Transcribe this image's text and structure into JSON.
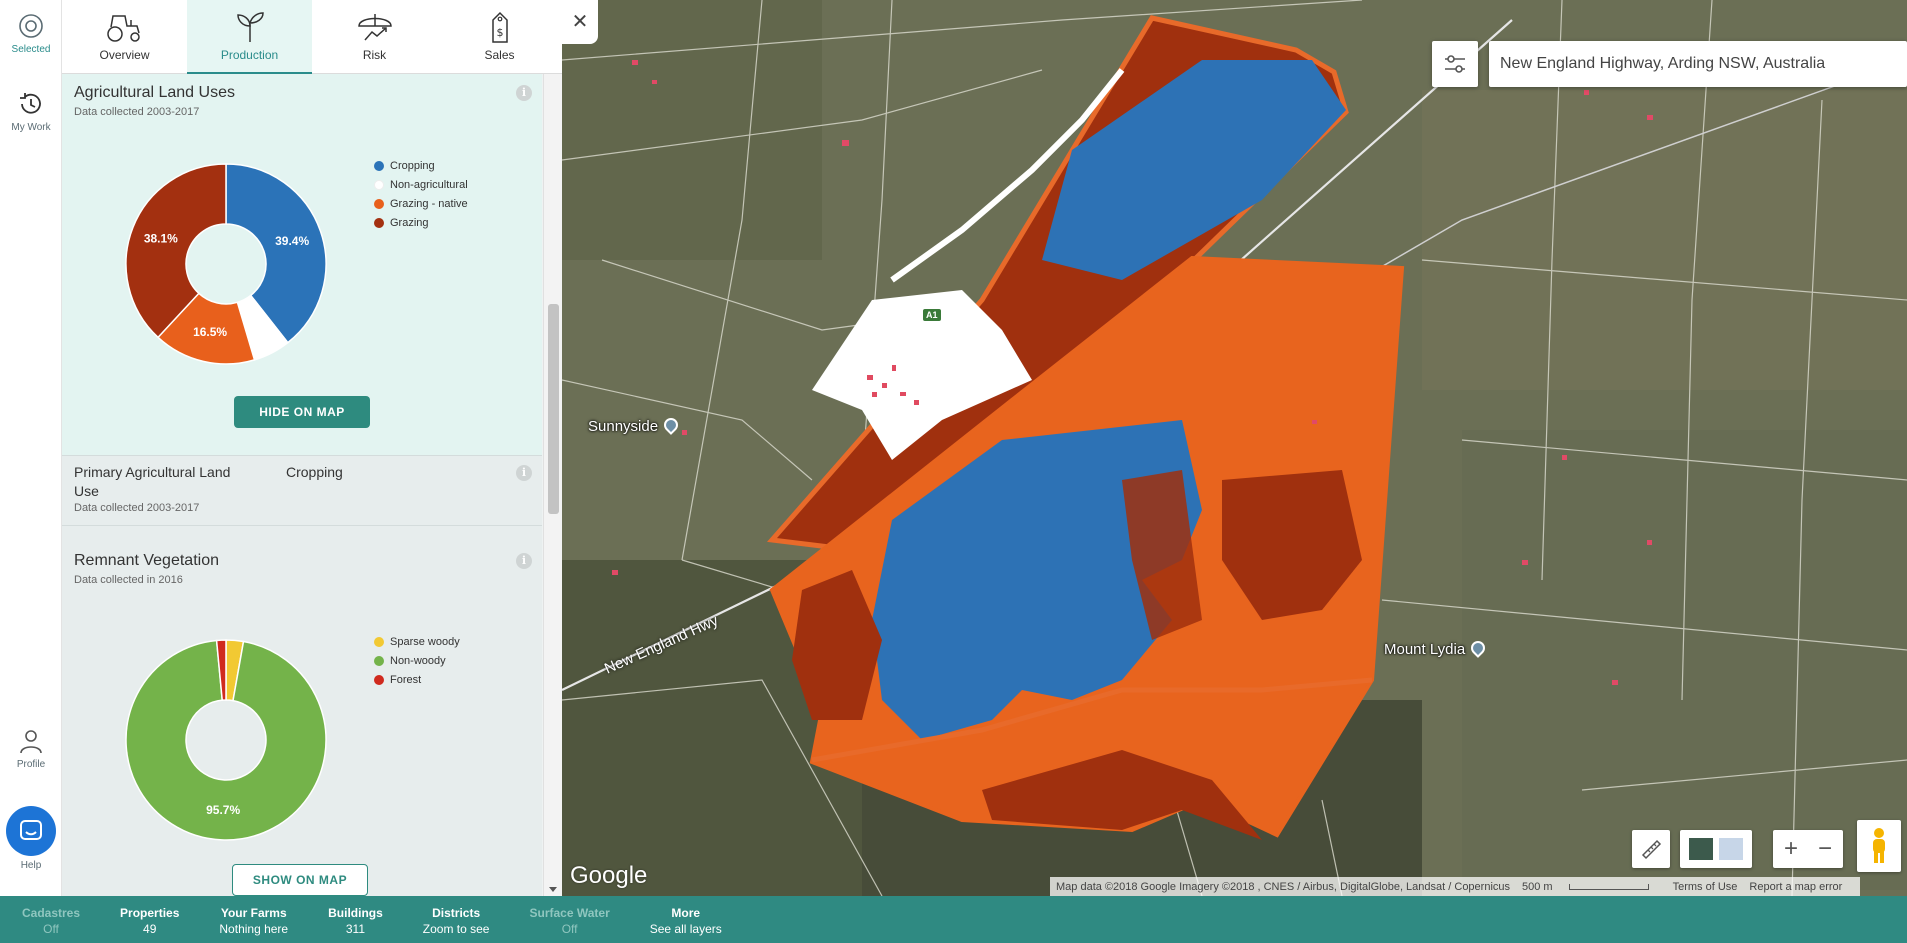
{
  "rail": {
    "selected_label": "Selected",
    "mywork_label": "My Work",
    "profile_label": "Profile",
    "help_label": "Help"
  },
  "tabs": [
    {
      "label": "Overview",
      "icon": "tractor-icon"
    },
    {
      "label": "Production",
      "icon": "sprout-icon"
    },
    {
      "label": "Risk",
      "icon": "umbrella-chart-icon"
    },
    {
      "label": "Sales",
      "icon": "price-tag-icon"
    }
  ],
  "active_tab": "Production",
  "land_uses": {
    "title": "Agricultural Land Uses",
    "subtitle": "Data collected 2003-2017",
    "button": "HIDE ON MAP",
    "pct_labels": [
      "39.4%",
      "16.5%",
      "38.1%"
    ]
  },
  "primary_land_use": {
    "title_line1": "Primary Agricultural Land",
    "title_line2": "Use",
    "value": "Cropping",
    "subtitle": "Data collected 2003-2017"
  },
  "remnant_veg": {
    "title": "Remnant Vegetation",
    "subtitle": "Data collected in 2016",
    "button": "SHOW ON MAP",
    "pct_labels": [
      "95.7%"
    ]
  },
  "chart_data": [
    {
      "type": "pie",
      "title": "Agricultural Land Uses",
      "categories": [
        "Cropping",
        "Non-agricultural",
        "Grazing - native",
        "Grazing"
      ],
      "values": [
        39.4,
        6.0,
        16.5,
        38.1
      ],
      "colors": [
        "#2b73b8",
        "#ffffff",
        "#e8601c",
        "#a33010"
      ],
      "legend_position": "right"
    },
    {
      "type": "pie",
      "title": "Remnant Vegetation",
      "categories": [
        "Sparse woody",
        "Non-woody",
        "Forest"
      ],
      "values": [
        2.8,
        95.7,
        1.5
      ],
      "colors": [
        "#f2c933",
        "#74b34a",
        "#d02a1e"
      ],
      "legend_position": "right"
    }
  ],
  "map": {
    "search_value": "New England Highway, Arding NSW, Australia",
    "places": [
      "Sunnyside",
      "Mount Lydia"
    ],
    "road_label": "New England Hwy",
    "route_badge": "A1",
    "google": "Google",
    "attribution": "Map data ©2018 Google Imagery ©2018 , CNES / Airbus, DigitalGlobe, Landsat / Copernicus",
    "scale": "500 m",
    "terms": "Terms of Use",
    "report": "Report a map error"
  },
  "layers": [
    {
      "name": "Cadastres",
      "status": "Off",
      "off": true
    },
    {
      "name": "Properties",
      "status": "49",
      "off": false
    },
    {
      "name": "Your Farms",
      "status": "Nothing here",
      "off": false
    },
    {
      "name": "Buildings",
      "status": "311",
      "off": false
    },
    {
      "name": "Districts",
      "status": "Zoom to see",
      "off": false
    },
    {
      "name": "Surface Water",
      "status": "Off",
      "off": true
    },
    {
      "name": "More",
      "status": "See all layers",
      "off": false
    }
  ]
}
